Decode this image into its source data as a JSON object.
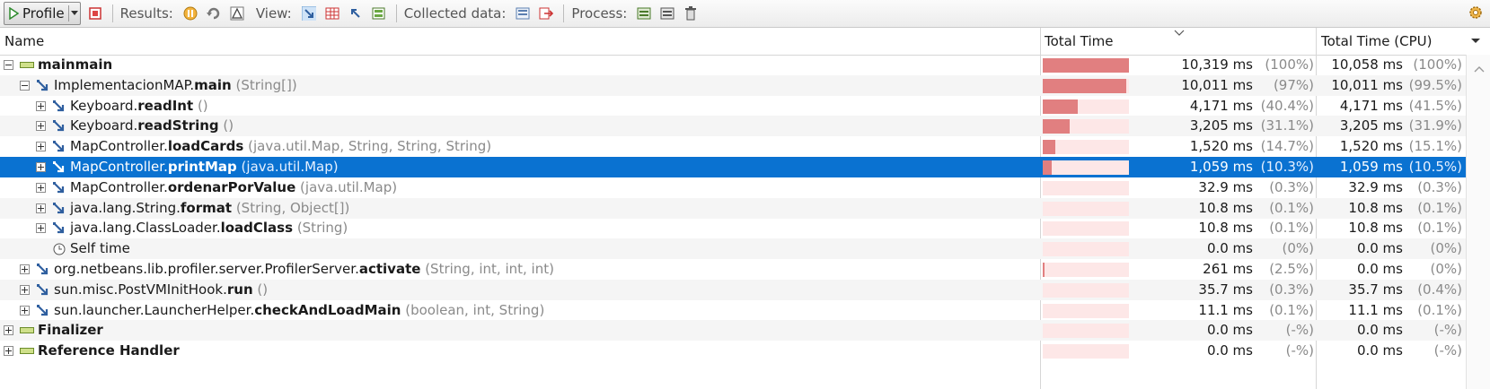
{
  "toolbar": {
    "profile_label": "Profile",
    "results_label": "Results:",
    "view_label": "View:",
    "collected_label": "Collected data:",
    "process_label": "Process:"
  },
  "header": {
    "name": "Name",
    "total_time": "Total Time",
    "total_time_cpu": "Total Time (CPU)"
  },
  "colors": {
    "bar": "#e17f80",
    "bar_bg": "#fde7e7",
    "selection": "#0a72d1"
  },
  "rows": [
    {
      "cls": "main",
      "method": "main",
      "args": "",
      "bar": 100,
      "time": "10,319 ms",
      "pct": "(100%)",
      "cpu": "10,058 ms",
      "cpu_pct": "(100%)"
    },
    {
      "cls": "ImplementacionMAP.",
      "method": "main",
      "args": "(String[])",
      "bar": 97,
      "time": "10,011 ms",
      "pct": "(97%)",
      "cpu": "10,011 ms",
      "cpu_pct": "(99.5%)"
    },
    {
      "cls": "Keyboard.",
      "method": "readInt",
      "args": "()",
      "bar": 40.4,
      "time": "4,171 ms",
      "pct": "(40.4%)",
      "cpu": "4,171 ms",
      "cpu_pct": "(41.5%)"
    },
    {
      "cls": "Keyboard.",
      "method": "readString",
      "args": "()",
      "bar": 31.1,
      "time": "3,205 ms",
      "pct": "(31.1%)",
      "cpu": "3,205 ms",
      "cpu_pct": "(31.9%)"
    },
    {
      "cls": "MapController.",
      "method": "loadCards",
      "args": "(java.util.Map, String, String, String)",
      "bar": 14.7,
      "time": "1,520 ms",
      "pct": "(14.7%)",
      "cpu": "1,520 ms",
      "cpu_pct": "(15.1%)"
    },
    {
      "cls": "MapController.",
      "method": "printMap",
      "args": "(java.util.Map)",
      "bar": 10.3,
      "time": "1,059 ms",
      "pct": "(10.3%)",
      "cpu": "1,059 ms",
      "cpu_pct": "(10.5%)"
    },
    {
      "cls": "MapController.",
      "method": "ordenarPorValue",
      "args": "(java.util.Map)",
      "bar": 0.3,
      "time": "32.9 ms",
      "pct": "(0.3%)",
      "cpu": "32.9 ms",
      "cpu_pct": "(0.3%)"
    },
    {
      "cls": "java.lang.String.",
      "method": "format",
      "args": "(String, Object[])",
      "bar": 0.1,
      "time": "10.8 ms",
      "pct": "(0.1%)",
      "cpu": "10.8 ms",
      "cpu_pct": "(0.1%)"
    },
    {
      "cls": "java.lang.ClassLoader.",
      "method": "loadClass",
      "args": "(String)",
      "bar": 0.1,
      "time": "10.8 ms",
      "pct": "(0.1%)",
      "cpu": "10.8 ms",
      "cpu_pct": "(0.1%)"
    },
    {
      "cls": "Self time",
      "method": "",
      "args": "",
      "bar": 0,
      "time": "0.0 ms",
      "pct": "(0%)",
      "cpu": "0.0 ms",
      "cpu_pct": "(0%)"
    },
    {
      "cls": "org.netbeans.lib.profiler.server.ProfilerServer.",
      "method": "activate",
      "args": "(String, int, int, int)",
      "bar": 2.5,
      "time": "261 ms",
      "pct": "(2.5%)",
      "cpu": "0.0 ms",
      "cpu_pct": "(0%)"
    },
    {
      "cls": "sun.misc.PostVMInitHook.",
      "method": "run",
      "args": "()",
      "bar": 0.3,
      "time": "35.7 ms",
      "pct": "(0.3%)",
      "cpu": "35.7 ms",
      "cpu_pct": "(0.4%)"
    },
    {
      "cls": "sun.launcher.LauncherHelper.",
      "method": "checkAndLoadMain",
      "args": "(boolean, int, String)",
      "bar": 0.1,
      "time": "11.1 ms",
      "pct": "(0.1%)",
      "cpu": "11.1 ms",
      "cpu_pct": "(0.1%)"
    },
    {
      "cls": "Finalizer",
      "method": "",
      "args": "",
      "bar": 0,
      "time": "0.0 ms",
      "pct": "(-%)",
      "cpu": "0.0 ms",
      "cpu_pct": "(-%)"
    },
    {
      "cls": "Reference Handler",
      "method": "",
      "args": "",
      "bar": 0,
      "time": "0.0 ms",
      "pct": "(-%)",
      "cpu": "0.0 ms",
      "cpu_pct": "(-%)"
    }
  ]
}
